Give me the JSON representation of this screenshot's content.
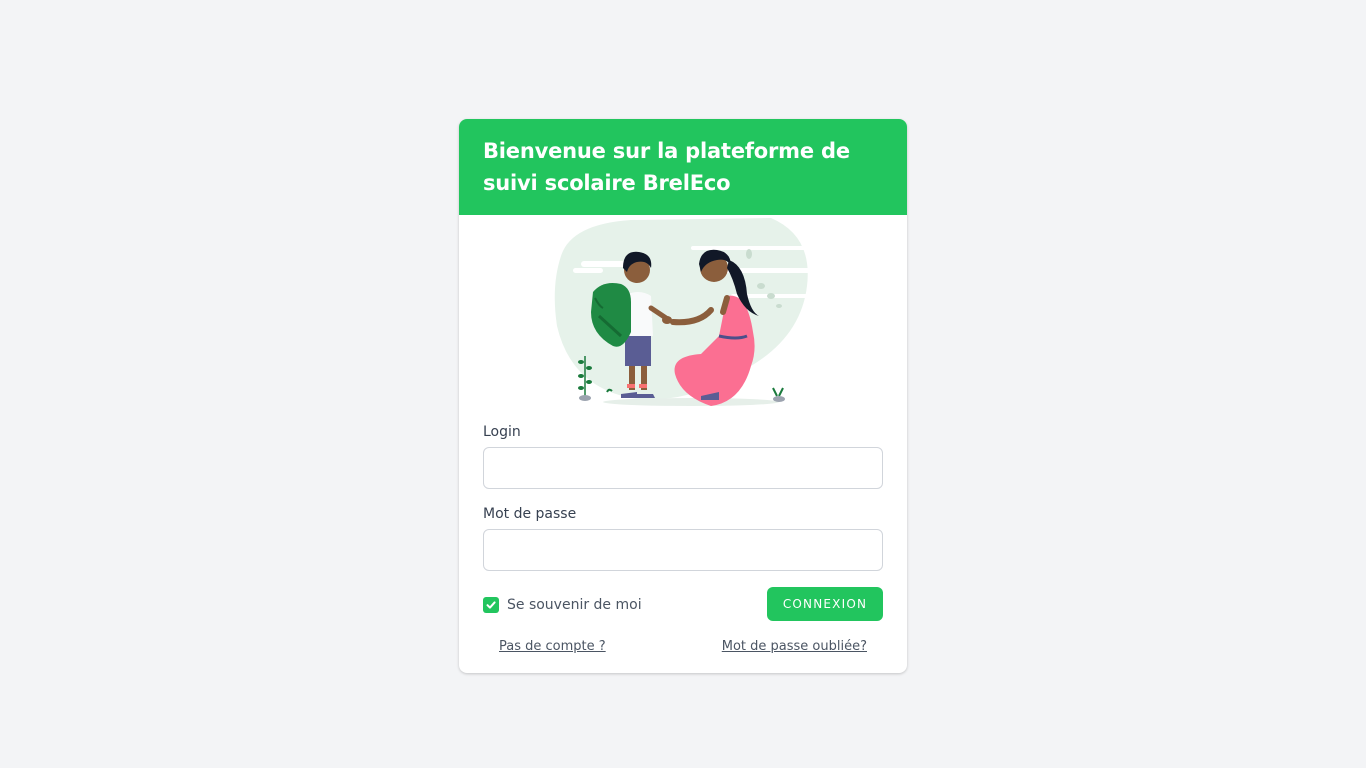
{
  "header": {
    "title": "Bienvenue sur la plateforme de suivi scolaire BrelEco"
  },
  "illustration": {
    "icon": "parent-child-school-illustration"
  },
  "form": {
    "login_label": "Login",
    "login_value": "",
    "password_label": "Mot de passe",
    "password_value": "",
    "remember_label": "Se souvenir de moi",
    "remember_checked": true,
    "submit_label": "CONNEXION"
  },
  "links": {
    "no_account": "Pas de compte ?",
    "forgot_password": "Mot de passe oubliée?"
  },
  "colors": {
    "accent": "#22c55e",
    "background": "#f3f4f6",
    "text": "#374151"
  }
}
